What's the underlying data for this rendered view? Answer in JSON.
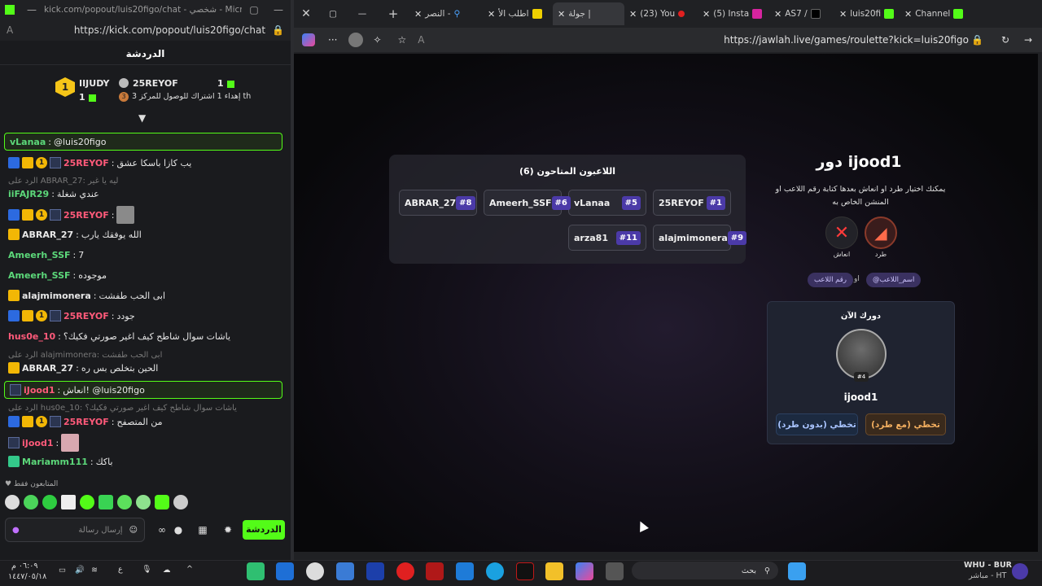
{
  "left_window": {
    "title": "kick.com/popout/luis20figo/chat - شخصي - Micr...",
    "url": "https://kick.com/popout/luis20figo/chat",
    "chat_header": "الدردشة",
    "leaderboard": {
      "first_rank": "1",
      "first_user": "IIJUDY",
      "first_count": "1",
      "second_user": "25REYOF",
      "second_count": "1",
      "progress_note": "إهداء 1 اشتراك للوصول للمركز 3 th",
      "third_rank": "3"
    },
    "messages": [
      {
        "user": "vLanaa",
        "text": "@luis20figo"
      },
      {
        "user": "25REYOF",
        "text": "يب كازا باسكا عشق"
      },
      {
        "reply_note": "الرد على ABRAR_27: ليه يا غير"
      },
      {
        "user": "iiFAJR29",
        "text": "عندي شغلة"
      },
      {
        "user": "25REYOF",
        "text": ""
      },
      {
        "user": "ABRAR_27",
        "text": "الله يوفقك يارب"
      },
      {
        "user": "Ameerh_SSF",
        "text": "7"
      },
      {
        "user": "Ameerh_SSF",
        "text": "موجوده"
      },
      {
        "user": "alajmimonera",
        "text": "ابى الحب طفشت"
      },
      {
        "user": "25REYOF",
        "text": "جودد"
      },
      {
        "user": "hus0e_10",
        "text": "ياشات سوال شاطح كيف اغير صورتي فكيك؟"
      },
      {
        "reply_note": "الرد على alajmimonera: ابى الحب طفشت"
      },
      {
        "user": "ABRAR_27",
        "text": "الحين بتخلص بس ره"
      },
      {
        "user": "iJood1",
        "text": "انعاش! @luis20figo"
      },
      {
        "reply_note": "الرد على hus0e_10: ياشات سوال شاطح كيف اغير صورتي فكيك؟"
      },
      {
        "user": "25REYOF",
        "text": "من المتصفح"
      },
      {
        "user": "iJood1",
        "text": ""
      },
      {
        "user": "Mariamm111",
        "text": "باكك"
      }
    ],
    "followers_only": "المتابعون فقط",
    "input_placeholder": "إرسال رسالة",
    "send_label": "الدردشة"
  },
  "right_window": {
    "tabs": [
      {
        "label": "Channel",
        "icon": "kick-icon"
      },
      {
        "label": "luis20fi",
        "icon": "kick-icon"
      },
      {
        "label": "AS7 /",
        "icon": "x-icon"
      },
      {
        "label": "(5) Insta",
        "icon": "instagram-icon"
      },
      {
        "label": "(23) You",
        "icon": "youtube-icon"
      },
      {
        "label": "جولة | ",
        "icon": "jawlah-icon"
      },
      {
        "label": "اطلب الأ",
        "icon": "h-icon"
      },
      {
        "label": "النصر -",
        "icon": "search-icon"
      }
    ],
    "url": "https://jawlah.live/games/roulette?kick=luis20figo",
    "game": {
      "players_title": "اللاعبون المتاحون (6)",
      "players": [
        {
          "name": "25REYOF",
          "num": "#1"
        },
        {
          "name": "vLanaa",
          "num": "#5"
        },
        {
          "name": "Ameerh_SSF",
          "num": "#6"
        },
        {
          "name": "ABRAR_27",
          "num": "#8"
        },
        {
          "name": "alajmimonera",
          "num": "#9"
        },
        {
          "name": "arza81",
          "num": "#11"
        }
      ],
      "turn_title": "دور ijood1",
      "turn_desc": "يمكنك اختيار طرد او انعاش بعدها كتابة رقم اللاعب او المنشن الخاص به",
      "kick_label": "طرد",
      "revive_label": "انعاش",
      "pill_number": "رقم اللاعب",
      "or_label": "او",
      "pill_name": "@اسم_اللاعب",
      "now_title": "دورك الآن",
      "now_badge": "#4",
      "now_name": "ijood1",
      "skip_with_kick": "تخطي (مع طرد)",
      "skip_no_kick": "تخطي (بدون طرد)"
    }
  },
  "taskbar": {
    "time": "٠٦:٠٩ م",
    "date": "١٤٤٧/٠٥/١٨",
    "search_label": "بحث",
    "match": "WHU - BUR",
    "match_status": "مباشر - HT",
    "lang": "ع"
  },
  "colors": {
    "kick_green": "#53fc18",
    "accent_purple": "#4b3aa8",
    "skip_orange": "#3a2a1c"
  }
}
